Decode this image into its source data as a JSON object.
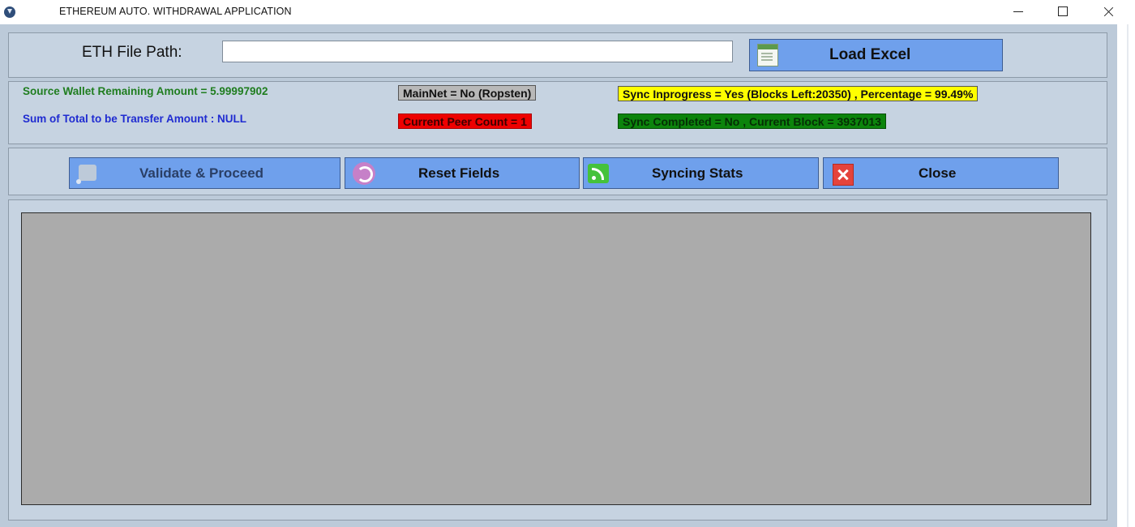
{
  "window": {
    "title": "ETHEREUM AUTO. WITHDRAWAL APPLICATION",
    "icon": "app-download-icon"
  },
  "file_section": {
    "label": "ETH File Path:",
    "input_value": "",
    "load_button": "Load Excel"
  },
  "status": {
    "source_wallet": "Source Wallet Remaining Amount = 5.99997902",
    "sum_total": "Sum of Total to be Transfer Amount : NULL",
    "mainnet": "MainNet = No (Ropsten)",
    "peer_count": "Current Peer Count = 1",
    "sync_progress": "Sync Inprogress = Yes (Blocks Left:20350) , Percentage = 99.49%",
    "sync_completed": "Sync Completed = No , Current Block = 3937013",
    "colors": {
      "source_wallet": "#1f7d1f",
      "sum_total": "#1f2bd1",
      "mainnet_bg": "#b8b8b8",
      "peer_bg": "#ee0000",
      "sync_progress_bg": "#ffff00",
      "sync_completed_bg": "#0c840c"
    }
  },
  "actions": {
    "validate": "Validate & Proceed",
    "reset": "Reset Fields",
    "sync_stats": "Syncing Stats",
    "close": "Close"
  },
  "icons": {
    "load": "excel-icon",
    "validate": "validate-icon",
    "reset": "refresh-icon",
    "sync_stats": "rss-icon",
    "close": "close-icon"
  }
}
